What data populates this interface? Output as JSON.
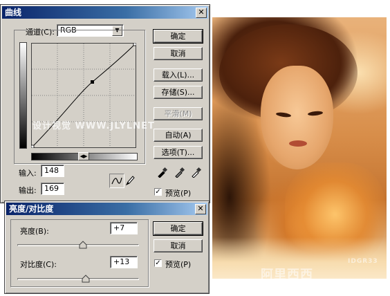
{
  "curves": {
    "title": "曲线",
    "channel_label": "通道(C):",
    "channel_value": "RGB",
    "input_label": "输入:",
    "input_value": "148",
    "output_label": "输出:",
    "output_value": "169",
    "buttons": {
      "ok": "确定",
      "cancel": "取消",
      "load": "载入(L)...",
      "save": "存储(S)...",
      "smooth": "平滑(M)",
      "auto": "自动(A)",
      "options": "选项(T)..."
    },
    "preview_label": "预览(P)",
    "preview_checked": true,
    "watermark": "设计视觉 WWW.JLYLNET"
  },
  "brightness_contrast": {
    "title": "亮度/对比度",
    "brightness_label": "亮度(B):",
    "brightness_value": "+7",
    "contrast_label": "对比度(C):",
    "contrast_value": "+13",
    "buttons": {
      "ok": "确定",
      "cancel": "取消"
    },
    "preview_label": "预览(P)",
    "preview_checked": true
  },
  "photo_watermark": "阿里西西",
  "photo_watermark_small": "IDGR33"
}
